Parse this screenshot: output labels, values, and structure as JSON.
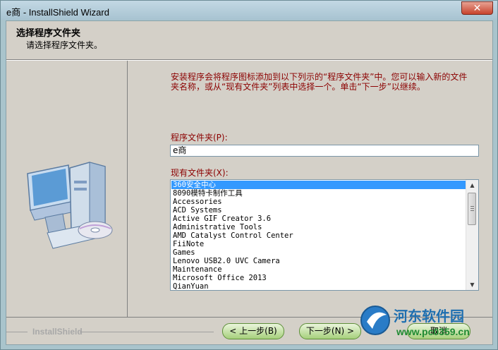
{
  "window": {
    "title": "e商 - InstallShield Wizard",
    "close_label": "✕"
  },
  "header": {
    "title": "选择程序文件夹",
    "subtitle": "请选择程序文件夹。"
  },
  "content": {
    "instruction": "安装程序会将程序图标添加到以下列示的“程序文件夹”中。您可以输入新的文件\n夹名称，或从“现有文件夹”列表中选择一个。单击“下一步”以继续。",
    "program_folder_label": "程序文件夹(P):",
    "program_folder_value": "e商",
    "existing_folders_label": "现有文件夹(X):",
    "existing_folders": [
      "360安全中心",
      "8090模特卡制作工具",
      "Accessories",
      "ACD Systems",
      "Active GIF Creator 3.6",
      "Administrative Tools",
      "AMD Catalyst Control Center",
      "FiiNote",
      "Games",
      "Lenovo USB2.0 UVC Camera",
      "Maintenance",
      "Microsoft Office 2013",
      "QianYuan"
    ],
    "selected_folder_index": 0
  },
  "footer": {
    "brand": "InstallShield",
    "back_label": "< 上一步(B)",
    "next_label": "下一步(N) >",
    "cancel_label": "取消"
  },
  "watermark": {
    "title": "河东软件园",
    "url": "www.pc0359.cn"
  },
  "colors": {
    "selection": "#3399ff",
    "label_text": "#8b0000",
    "button_green": "#a6d07c"
  }
}
